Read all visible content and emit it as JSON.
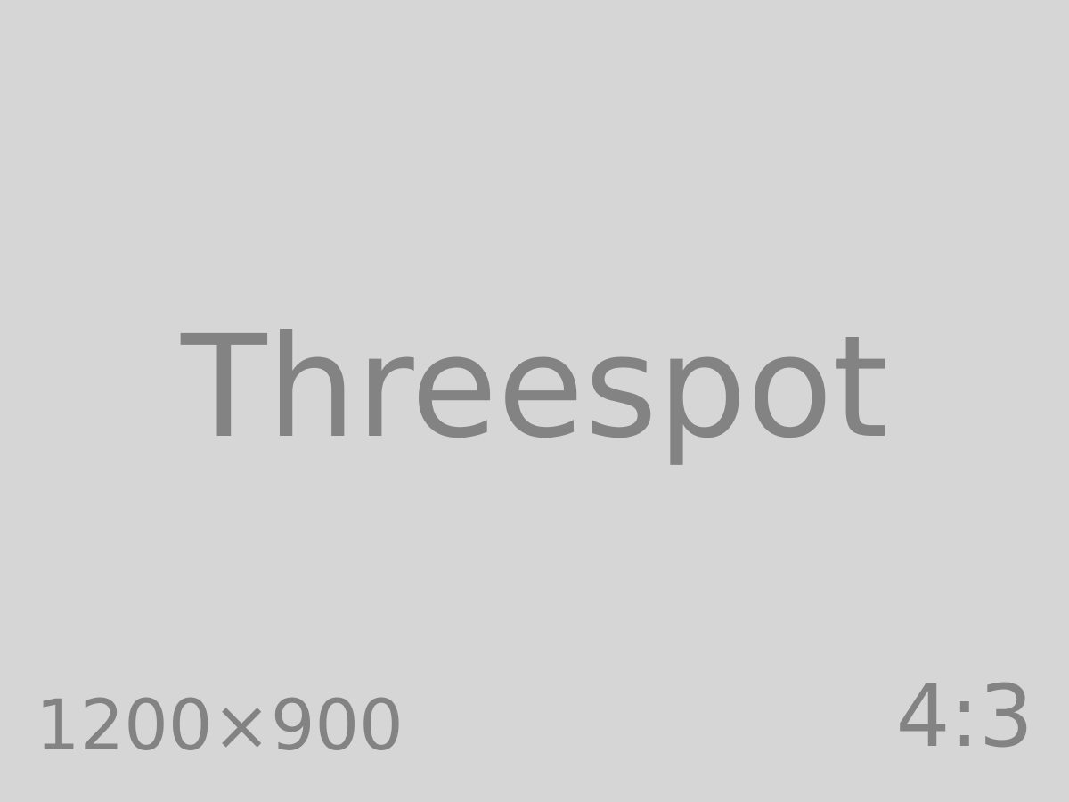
{
  "placeholder": {
    "title": "Threespot",
    "dimensions": "1200×900",
    "aspect_ratio": "4:3"
  },
  "colors": {
    "background": "#d6d6d6",
    "text": "#838383"
  }
}
